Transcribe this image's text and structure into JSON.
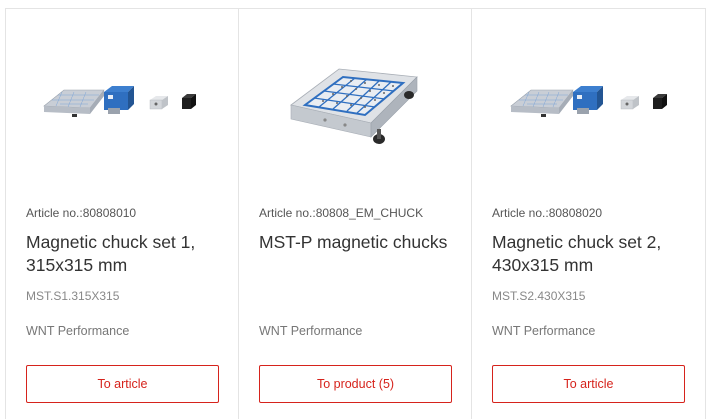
{
  "products": [
    {
      "image_icon": "magnetic-chuck-set-image",
      "article_label": "Article no.:",
      "article_no": "80808010",
      "title": "Magnetic chuck set 1, 315x315 mm",
      "code": "MST.S1.315X315",
      "brand": "WNT Performance",
      "button_label": "To article"
    },
    {
      "image_icon": "magnetic-chuck-image",
      "article_label": "Article no.:",
      "article_no": "80808_EM_CHUCK",
      "title": "MST-P magnetic chucks",
      "code": "",
      "brand": "WNT Performance",
      "button_label": "To product (5)"
    },
    {
      "image_icon": "magnetic-chuck-set-image",
      "article_label": "Article no.:",
      "article_no": "80808020",
      "title": "Magnetic chuck set 2, 430x315 mm",
      "code": "MST.S2.430X315",
      "brand": "WNT Performance",
      "button_label": "To article"
    }
  ],
  "colors": {
    "accent": "#d6231c",
    "border": "#e4e4e4",
    "chuck_blue": "#2f6fc0"
  }
}
